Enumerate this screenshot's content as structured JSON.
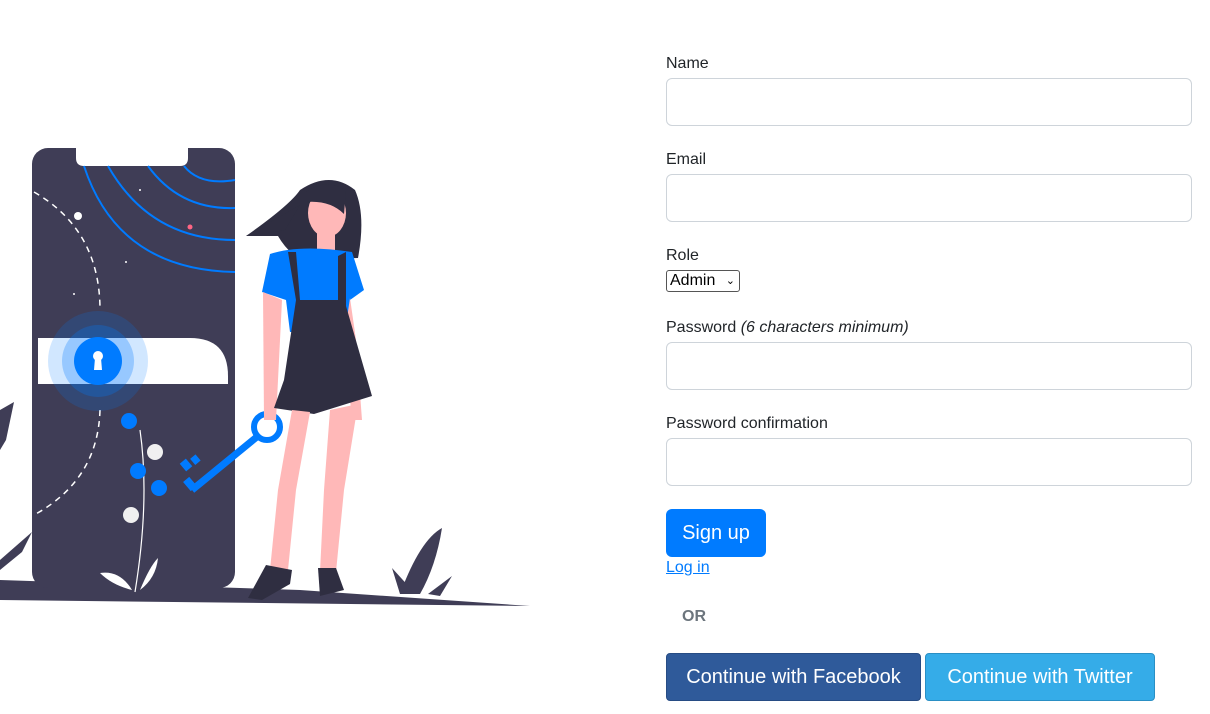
{
  "form": {
    "name_label": "Name",
    "name_value": "",
    "email_label": "Email",
    "email_value": "",
    "role_label": "Role",
    "role_selected": "Admin",
    "password_label": "Password",
    "password_hint": "(6 characters minimum)",
    "password_value": "",
    "confirmation_label": "Password confirmation",
    "confirmation_value": "",
    "signup_label": "Sign up",
    "login_label": "Log in",
    "or_label": "OR",
    "facebook_label": "Continue with Facebook",
    "twitter_label": "Continue with Twitter"
  },
  "icons": {
    "illustration": "phone-lock-key-illustration",
    "role_dropdown": "chevron-down-icon"
  },
  "colors": {
    "primary": "#007bff",
    "facebook": "#2f5a9a",
    "twitter": "#35ace8",
    "dark": "#3f3d56"
  }
}
